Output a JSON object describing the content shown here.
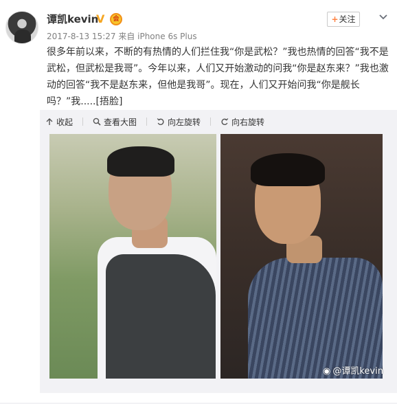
{
  "post": {
    "username": "谭凯kevin",
    "verified_mark": "V",
    "member_mark": "会",
    "meta": "2017-8-13 15:27 来自 iPhone 6s Plus",
    "follow_label": "关注",
    "follow_plus": "+",
    "content_lines": [
      "很多年前以来，不断的有热情的人们拦住我“你是武松？”我也热情的回答“我不是",
      "武松，但武松是我哥”。今年以来，人们又开始激动的问我“你是赵东来？”我也激",
      "动的回答“我不是赵东来，但他是我哥”。现在，人们又开始问我“你是舰长",
      "吗？”我....."
    ],
    "emoticon": "[捂脸]"
  },
  "toolbar": {
    "collapse": "收起",
    "view_large": "查看大图",
    "rotate_left": "向左旋转",
    "rotate_right": "向右旋转"
  },
  "media": {
    "watermark": "@谭凯kevin"
  },
  "colors": {
    "follow_plus": "#ff8140",
    "verified": "#f5a623",
    "meta_text": "#808080",
    "media_bg": "#f2f2f5"
  },
  "icons": [
    "avatar",
    "verified-badge-icon",
    "member-badge-icon",
    "chevron-down-icon",
    "collapse-icon",
    "zoom-icon",
    "rotate-left-icon",
    "rotate-right-icon",
    "weibo-logo-icon"
  ]
}
